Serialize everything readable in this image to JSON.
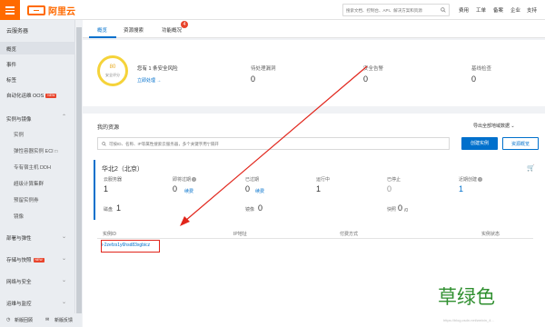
{
  "topbar": {
    "logo_text": "阿里云",
    "search_placeholder": "搜索文档、控制台、API、解决方案和资源",
    "links": [
      "费用",
      "工单",
      "备案",
      "企业",
      "支持"
    ],
    "icons": [
      "bell-icon",
      "cart-icon",
      "help-icon",
      "language-icon"
    ]
  },
  "sidebar": {
    "title": "云服务器",
    "items": [
      {
        "label": "概览"
      },
      {
        "label": "事件"
      },
      {
        "label": "标签"
      },
      {
        "label": "自动化运维 OOS",
        "tag": "NEW"
      },
      {
        "label": "实例与镜像"
      },
      {
        "label": "实例"
      },
      {
        "label": "弹性容器实例 ECI"
      },
      {
        "label": "专有宿主机 DDH"
      },
      {
        "label": "超级计算集群"
      },
      {
        "label": "预留实例券"
      },
      {
        "label": "镜像"
      },
      {
        "label": "部署与弹性"
      },
      {
        "label": "存储与快照",
        "tag": "NEW"
      },
      {
        "label": "网络与安全"
      },
      {
        "label": "运维与监控"
      }
    ],
    "footer_left": "新版回顾",
    "footer_right": "新版反馈"
  },
  "tabs": [
    {
      "label": "概览"
    },
    {
      "label": "资源搜索"
    },
    {
      "label": "功能概况"
    }
  ],
  "tab_badge": "4",
  "security": {
    "score": "80",
    "score_label": "安全评分",
    "desc": "您有 1 条安全风险",
    "fix_link": "立即处理",
    "metrics": [
      {
        "title": "待处理漏洞",
        "value": "0"
      },
      {
        "title": "安全告警",
        "value": "0"
      },
      {
        "title": "基线检查",
        "value": "0"
      }
    ]
  },
  "resources": {
    "title": "我的资源",
    "export_link": "导出全部地域数据",
    "search_placeholder": "可按ID、名称、IP等属性搜索云服务器，多个关键字用“|”隔开",
    "create_button": "创建实例",
    "overview_button": "资源概览",
    "region": "华北2（北京）",
    "stats": [
      {
        "label": "云服务器",
        "value": "1"
      },
      {
        "label": "即将过期",
        "value": "0",
        "link": "续费"
      },
      {
        "label": "已过期",
        "value": "0",
        "link": "续费"
      },
      {
        "label": "运行中",
        "value": "1"
      },
      {
        "label": "已停止",
        "value": "0"
      },
      {
        "label": "近期创建",
        "value": "1"
      }
    ],
    "stats2": [
      {
        "label": "磁盘",
        "value": "1"
      },
      {
        "label": "镜像",
        "value": "0"
      },
      {
        "label": "快照",
        "value": "0",
        "suffix": "/0"
      }
    ],
    "table_headers": [
      "实例ID",
      "IP地址",
      "付费方式",
      "实例状态"
    ],
    "instance_id": "i-2zefzs1y6hsd83xgbicz"
  },
  "watermark": "草绿色",
  "watermark_credit": "https://blog.csdn.net/weixin_4..."
}
